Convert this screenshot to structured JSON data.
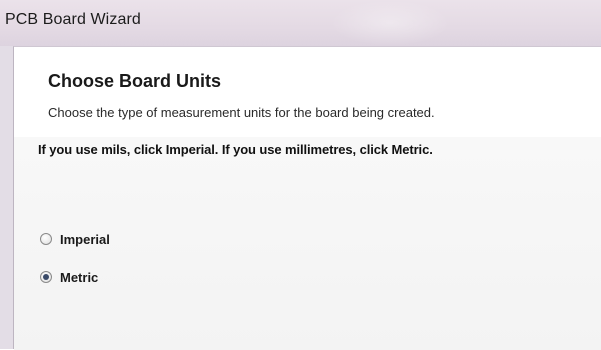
{
  "window": {
    "title": "PCB Board Wizard"
  },
  "page": {
    "heading": "Choose Board Units",
    "subheading": "Choose the type of measurement units for the board being created.",
    "instruction": "If you use mils, click Imperial. If you use millimetres, click Metric."
  },
  "units": {
    "options": [
      {
        "label": "Imperial",
        "selected": false
      },
      {
        "label": "Metric",
        "selected": true
      }
    ]
  },
  "colors": {
    "titlebar": "#e4dae4",
    "client_background": "#ffffff",
    "radio_dot": "#3a4a68"
  }
}
